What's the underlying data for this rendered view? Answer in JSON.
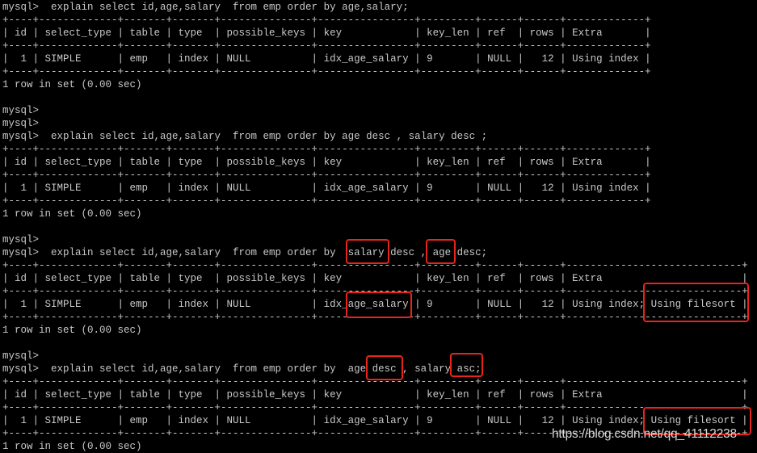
{
  "terminal": {
    "lines": [
      "mysql>  explain select id,age,salary  from emp order by age,salary;",
      "+----+-------------+-------+-------+---------------+----------------+---------+------+------+-------------+",
      "| id | select_type | table | type  | possible_keys | key            | key_len | ref  | rows | Extra       |",
      "+----+-------------+-------+-------+---------------+----------------+---------+------+------+-------------+",
      "|  1 | SIMPLE      | emp   | index | NULL          | idx_age_salary | 9       | NULL |   12 | Using index |",
      "+----+-------------+-------+-------+---------------+----------------+---------+------+------+-------------+",
      "1 row in set (0.00 sec)",
      "",
      "mysql>",
      "mysql>",
      "mysql>  explain select id,age,salary  from emp order by age desc , salary desc ;",
      "+----+-------------+-------+-------+---------------+----------------+---------+------+------+-------------+",
      "| id | select_type | table | type  | possible_keys | key            | key_len | ref  | rows | Extra       |",
      "+----+-------------+-------+-------+---------------+----------------+---------+------+------+-------------+",
      "|  1 | SIMPLE      | emp   | index | NULL          | idx_age_salary | 9       | NULL |   12 | Using index |",
      "+----+-------------+-------+-------+---------------+----------------+---------+------+------+-------------+",
      "1 row in set (0.00 sec)",
      "",
      "mysql>",
      "mysql>  explain select id,age,salary  from emp order by  salary desc , age desc;",
      "+----+-------------+-------+-------+---------------+----------------+---------+------+------+-----------------------------+",
      "| id | select_type | table | type  | possible_keys | key            | key_len | ref  | rows | Extra                       |",
      "+----+-------------+-------+-------+---------------+----------------+---------+------+------+-----------------------------+",
      "|  1 | SIMPLE      | emp   | index | NULL          | idx_age_salary | 9       | NULL |   12 | Using index; Using filesort |",
      "+----+-------------+-------+-------+---------------+----------------+---------+------+------+-----------------------------+",
      "1 row in set (0.00 sec)",
      "",
      "mysql>",
      "mysql>  explain select id,age,salary  from emp order by  age desc , salary asc;",
      "+----+-------------+-------+-------+---------------+----------------+---------+------+------+-----------------------------+",
      "| id | select_type | table | type  | possible_keys | key            | key_len | ref  | rows | Extra                       |",
      "+----+-------------+-------+-------+---------------+----------------+---------+------+------+-----------------------------+",
      "|  1 | SIMPLE      | emp   | index | NULL          | idx_age_salary | 9       | NULL |   12 | Using index; Using filesort |",
      "+----+-------------+-------+-------+---------------+----------------+---------+------+------+-----------------------------+",
      "1 row in set (0.00 sec)"
    ]
  },
  "colors": {
    "background": "#000000",
    "text": "#c8c8c8",
    "highlight": "#e8241c"
  },
  "watermark": "https://blog.csdn.net/qq_41112238"
}
